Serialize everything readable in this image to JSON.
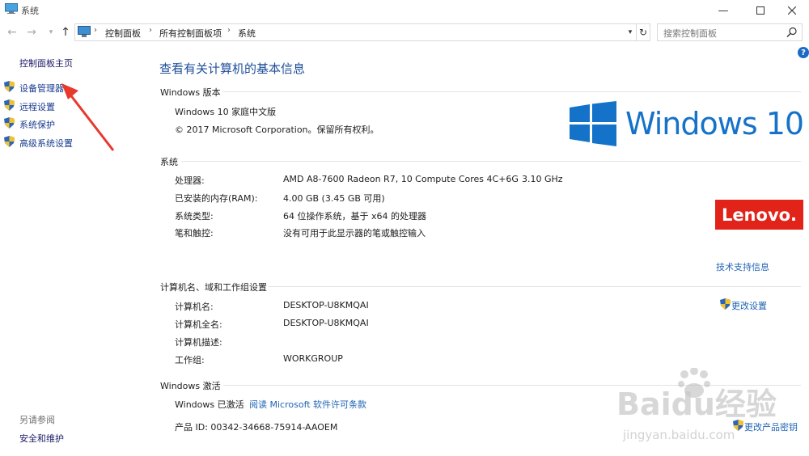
{
  "window": {
    "title": "系统"
  },
  "nav": {
    "breadcrumb": [
      "控制面板",
      "所有控制面板项",
      "系统"
    ],
    "search_placeholder": "搜索控制面板"
  },
  "sidebar": {
    "home": "控制面板主页",
    "items": [
      {
        "label": "设备管理器"
      },
      {
        "label": "远程设置"
      },
      {
        "label": "系统保护"
      },
      {
        "label": "高级系统设置"
      }
    ],
    "see_also_title": "另请参阅",
    "see_also_link": "安全和维护"
  },
  "main": {
    "title": "查看有关计算机的基本信息",
    "edition": {
      "header": "Windows 版本",
      "name": "Windows 10 家庭中文版",
      "copyright": "© 2017 Microsoft Corporation。保留所有权利。",
      "logo_text": "Windows 10"
    },
    "system": {
      "header": "系统",
      "processor_label": "处理器:",
      "processor_value": "AMD A8-7600 Radeon R7, 10 Compute Cores 4C+6G",
      "processor_speed": "3.10 GHz",
      "ram_label": "已安装的内存(RAM):",
      "ram_value": "4.00 GB (3.45 GB 可用)",
      "type_label": "系统类型:",
      "type_value": "64 位操作系统，基于 x64 的处理器",
      "pen_label": "笔和触控:",
      "pen_value": "没有可用于此显示器的笔或触控输入",
      "oem_logo": "Lenovo.",
      "support_link": "技术支持信息"
    },
    "computer": {
      "header": "计算机名、域和工作组设置",
      "name_label": "计算机名:",
      "name_value": "DESKTOP-U8KMQAI",
      "fullname_label": "计算机全名:",
      "fullname_value": "DESKTOP-U8KMQAI",
      "desc_label": "计算机描述:",
      "desc_value": "",
      "workgroup_label": "工作组:",
      "workgroup_value": "WORKGROUP",
      "change_link": "更改设置"
    },
    "activation": {
      "header": "Windows 激活",
      "status": "Windows 已激活",
      "license_link": "阅读 Microsoft 软件许可条款",
      "product_id": "产品 ID: 00342-34668-75914-AAOEM",
      "change_key_link": "更改产品密钥"
    }
  },
  "watermark": {
    "brand": "Baidu经验",
    "url": "jingyan.baidu.com"
  },
  "colors": {
    "link": "#1f64b5",
    "title_blue": "#1e4e9a",
    "windows_blue": "#1572c9",
    "lenovo_red": "#e2231a",
    "arrow_red": "#e8392d"
  }
}
